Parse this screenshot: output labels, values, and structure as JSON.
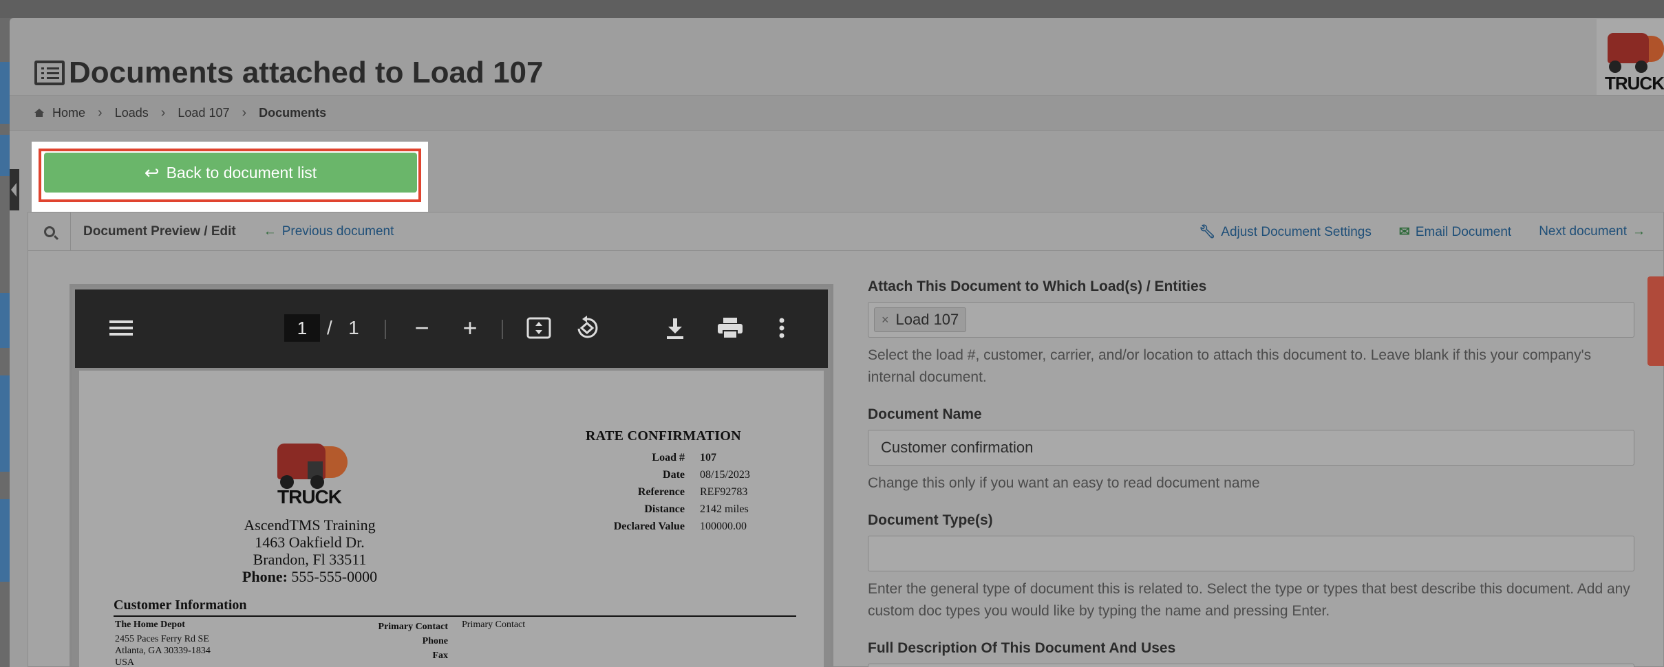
{
  "page": {
    "title": "Documents attached to Load 107"
  },
  "logo": {
    "text": "TRUCK"
  },
  "breadcrumb": [
    {
      "label": "Home"
    },
    {
      "label": "Loads"
    },
    {
      "label": "Load 107"
    },
    {
      "label": "Documents"
    }
  ],
  "back_button": {
    "label": "Back to document list"
  },
  "card": {
    "title": "Document Preview / Edit",
    "prev_link": "Previous document",
    "adjust_link": "Adjust Document Settings",
    "email_link": "Email Document",
    "next_link": "Next document"
  },
  "pdf_viewer": {
    "current_page": "1",
    "total_pages": "1"
  },
  "document": {
    "logo_text": "TRUCK",
    "company_name": "AscendTMS Training",
    "address_line1": "1463 Oakfield Dr.",
    "address_line2": "Brandon, Fl 33511",
    "phone_label": "Phone:",
    "phone": "555-555-0000",
    "rc_title": "RATE CONFIRMATION",
    "rc_rows": [
      {
        "label": "Load #",
        "value": "107"
      },
      {
        "label": "Date",
        "value": "08/15/2023"
      },
      {
        "label": "Reference",
        "value": "REF92783"
      },
      {
        "label": "Distance",
        "value": "2142 miles"
      },
      {
        "label": "Declared Value",
        "value": "100000.00"
      }
    ],
    "customer_heading": "Customer Information",
    "customer_name": "The Home Depot",
    "customer_address": [
      "2455 Paces Ferry Rd SE",
      "Atlanta, GA 30339-1834",
      "USA"
    ],
    "contact_labels": [
      "Primary Contact",
      "Phone",
      "Fax"
    ],
    "contact_value": "Primary Contact"
  },
  "form": {
    "attach_label": "Attach This Document to Which Load(s) / Entities",
    "attach_tag": "Load 107",
    "attach_help": "Select the load #, customer, carrier, and/or location to attach this document to. Leave blank if this your company's internal document.",
    "name_label": "Document Name",
    "name_value": "Customer confirmation",
    "name_help": "Change this only if you want an easy to read document name",
    "type_label": "Document Type(s)",
    "type_value": "",
    "type_help": "Enter the general type of document this is related to. Select the type or types that best describe this document. Add any custom doc types you would like by typing the name and pressing Enter.",
    "desc_label": "Full Description Of This Document And Uses"
  },
  "colors": {
    "back_button": "#6ab66a",
    "highlight_border": "#e0442f",
    "link": "#1f4f78",
    "toolbar": "#262626"
  }
}
